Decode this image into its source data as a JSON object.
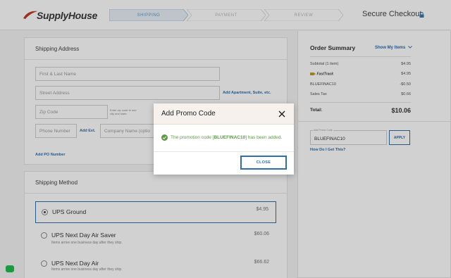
{
  "header": {
    "logo_text": "SupplyHouse",
    "steps": [
      {
        "label": "SHIPPING",
        "active": true
      },
      {
        "label": "PAYMENT",
        "active": false
      },
      {
        "label": "REVIEW",
        "active": false
      }
    ],
    "secure_checkout": "Secure Checkout"
  },
  "shipping_address": {
    "title": "Shipping Address",
    "placeholders": {
      "name": "First & Last Name",
      "street": "Street Address",
      "zip": "Zip Code",
      "phone": "Phone Number",
      "company": "Company Name (optio"
    },
    "add_apartment": "Add Apartment, Suite, etc.",
    "zip_hint_line1": "Enter zip code to see",
    "zip_hint_line2": "city and state.",
    "add_ext": "Add Ext.",
    "add_po": "Add PO Number"
  },
  "shipping_method": {
    "title": "Shipping Method",
    "options": [
      {
        "name": "UPS Ground",
        "price": "$4.95",
        "note": "",
        "selected": true
      },
      {
        "name": "UPS Next Day Air Saver",
        "price": "$60.06",
        "note": "Items arrive one business day after they ship.",
        "selected": false
      },
      {
        "name": "UPS Next Day Air",
        "price": "$66.62",
        "note": "Items arrive one business day after they ship.",
        "selected": false
      }
    ]
  },
  "order_summary": {
    "title": "Order Summary",
    "show_items": "Show My Items",
    "subtotal_label": "Subtotal (1 item)",
    "subtotal_value": "$4.95",
    "fasttrack_label": "FastTrack",
    "fasttrack_value": "$4.95",
    "promo_label": "BLUEFINAC10",
    "promo_value": "-$0.50",
    "tax_label": "Sales Tax",
    "tax_value": "$0.66",
    "total_label": "Total:",
    "total_value": "$10.06",
    "promo_field_label": "Add Promo Code",
    "promo_field_value": "BLUEFINAC10",
    "apply": "APPLY",
    "how_get": "How Do I Get This?"
  },
  "modal": {
    "title": "Add Promo Code",
    "msg_pre": "The promotion code [",
    "msg_code": "BLUEFINAC10",
    "msg_post": "] has been added.",
    "close_label": "CLOSE"
  },
  "colors": {
    "accent": "#2f6fa8",
    "success": "#5a9a44",
    "chat": "#1fbf4f"
  }
}
